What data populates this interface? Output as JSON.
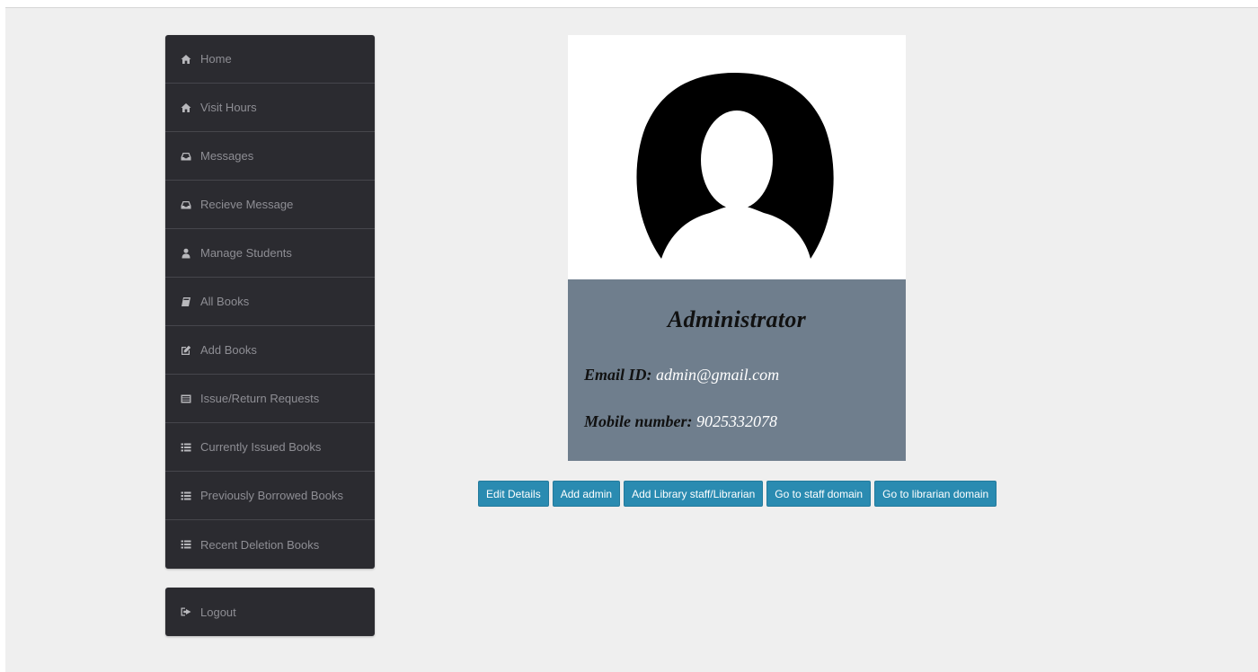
{
  "sidebar": {
    "items": [
      {
        "label": "Home",
        "icon": "home-icon"
      },
      {
        "label": "Visit Hours",
        "icon": "home-icon"
      },
      {
        "label": "Messages",
        "icon": "inbox-icon"
      },
      {
        "label": "Recieve Message",
        "icon": "inbox-icon"
      },
      {
        "label": "Manage Students",
        "icon": "user-icon"
      },
      {
        "label": "All Books",
        "icon": "book-icon"
      },
      {
        "label": "Add Books",
        "icon": "edit-icon"
      },
      {
        "label": "Issue/Return Requests",
        "icon": "list-alt-icon"
      },
      {
        "label": "Currently Issued Books",
        "icon": "list-icon"
      },
      {
        "label": "Previously Borrowed Books",
        "icon": "list-icon"
      },
      {
        "label": "Recent Deletion Books",
        "icon": "list-icon"
      }
    ],
    "logout": {
      "label": "Logout",
      "icon": "logout-icon"
    }
  },
  "profile": {
    "role": "Administrator",
    "email_label": "Email ID:",
    "email": "admin@gmail.com",
    "mobile_label": "Mobile number:",
    "mobile": "9025332078"
  },
  "actions": {
    "edit_details": "Edit Details",
    "add_admin": "Add admin",
    "add_staff": "Add Library staff/Librarian",
    "go_staff": "Go to staff domain",
    "go_librarian": "Go to librarian domain"
  },
  "colors": {
    "sidebar_bg": "#2b2b30",
    "info_panel_bg": "#6f7e8d",
    "button_bg": "#2a8bb1"
  }
}
